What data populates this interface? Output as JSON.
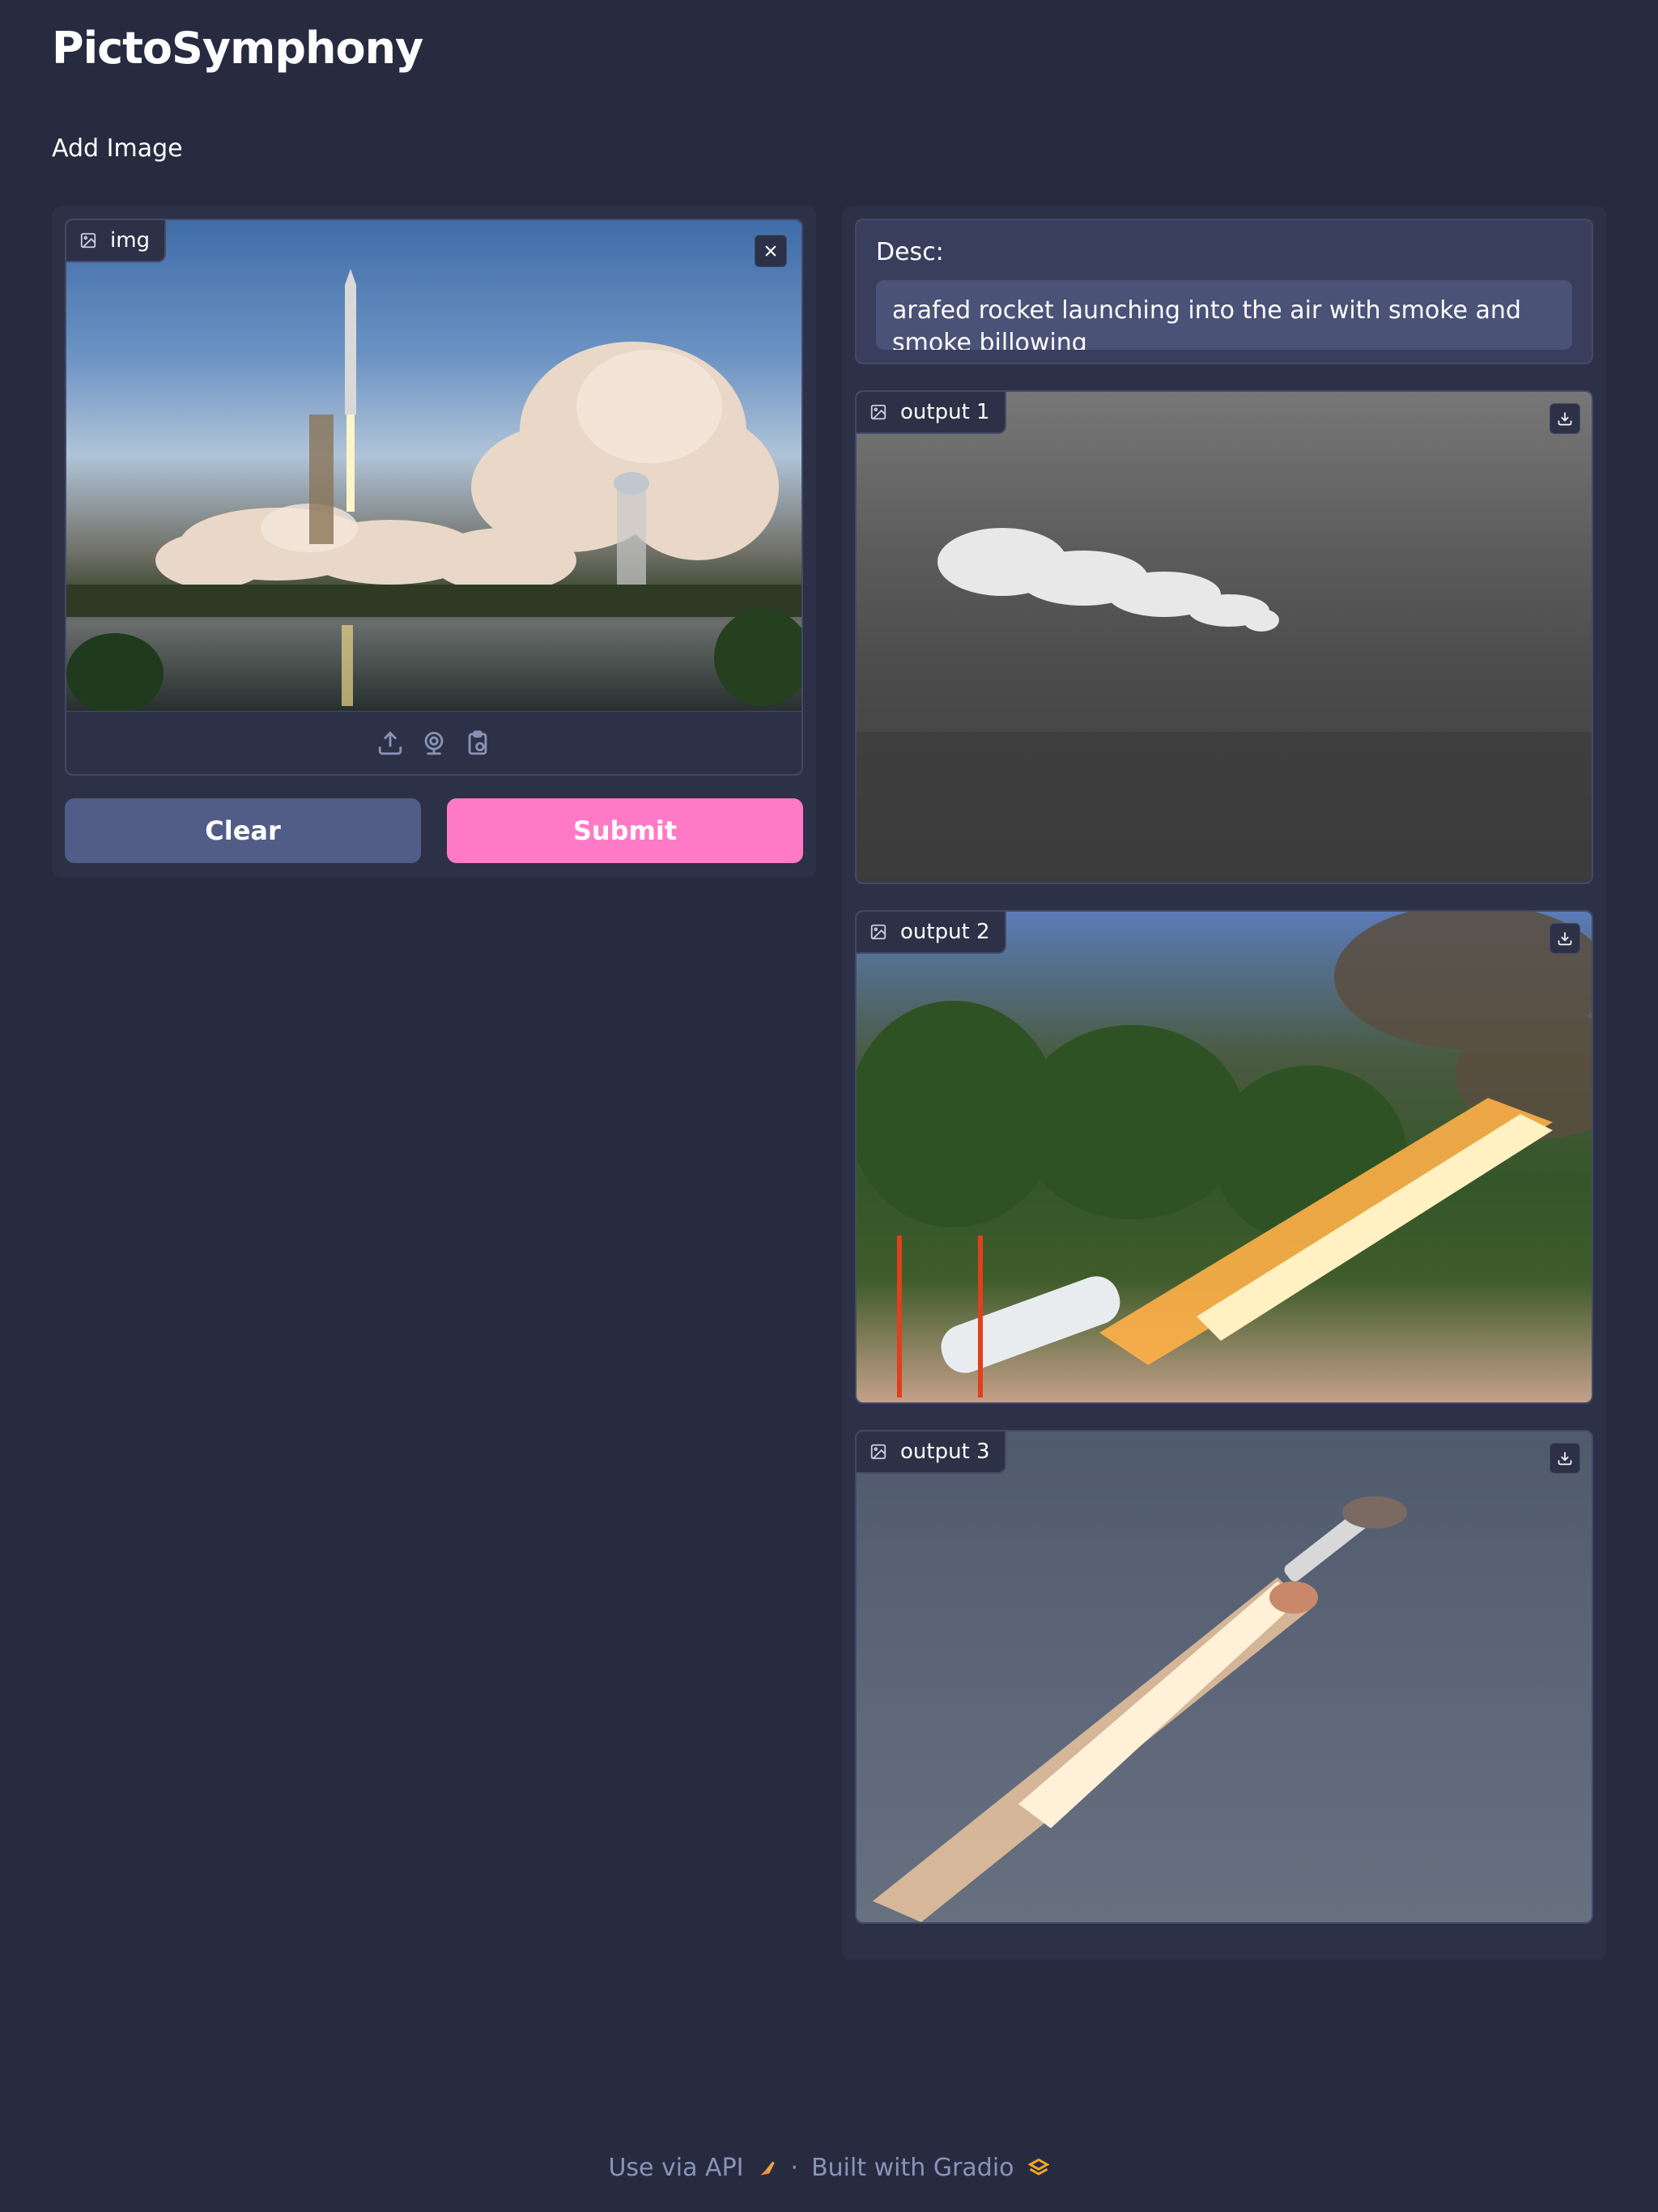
{
  "app": {
    "title": "PictoSymphony"
  },
  "section": {
    "heading": "Add Image"
  },
  "input": {
    "label": "img",
    "icon": "image-icon",
    "close_icon": "close-icon",
    "sources": [
      "upload-icon",
      "webcam-icon",
      "clipboard-icon"
    ]
  },
  "buttons": {
    "clear_label": "Clear",
    "submit_label": "Submit"
  },
  "desc": {
    "label": "Desc:",
    "value": "arafed rocket launching into the air with smoke and smoke billowing"
  },
  "outputs": [
    {
      "label": "output 1",
      "download_icon": "download-icon"
    },
    {
      "label": "output 2",
      "download_icon": "download-icon"
    },
    {
      "label": "output 3",
      "download_icon": "download-icon"
    }
  ],
  "footer": {
    "api_label": "Use via API",
    "separator": "·",
    "built_label": "Built with Gradio"
  },
  "colors": {
    "background": "#272b40",
    "panel": "#2c3147",
    "clear_button": "#515d87",
    "submit_button": "#ff7ac6",
    "footer_text": "#8a93b8"
  }
}
